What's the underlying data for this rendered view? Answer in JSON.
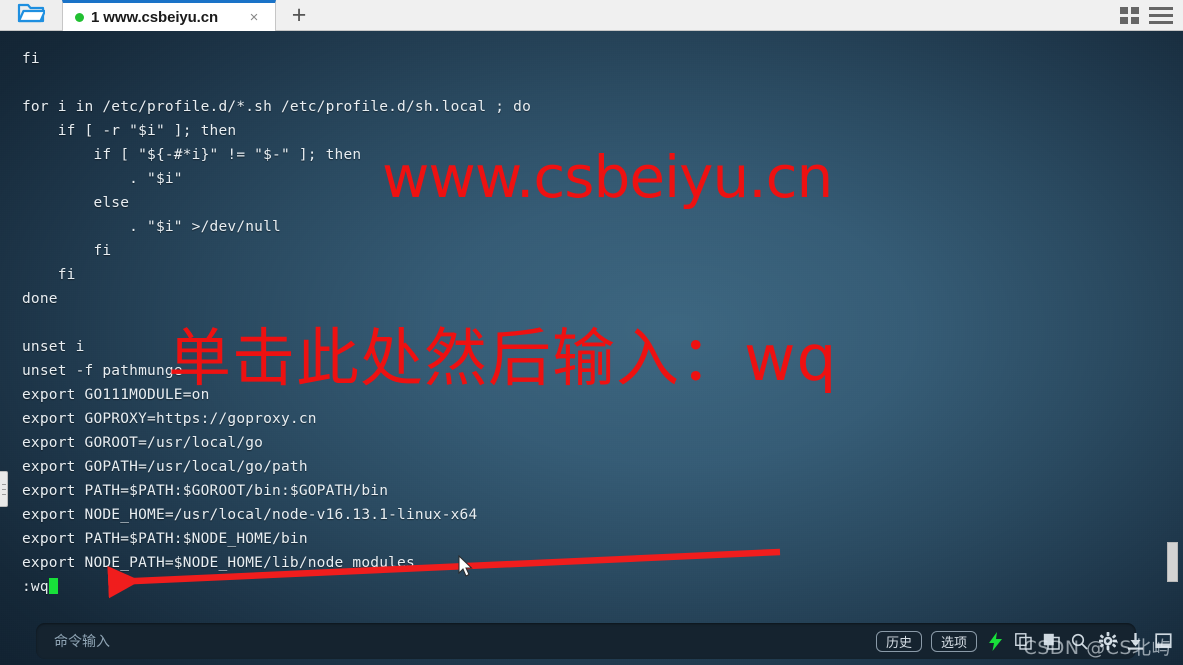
{
  "window": {
    "folder_icon": "open-folder-icon",
    "new_tab_label": "+",
    "grid_icon": "grid-view-icon",
    "menu_icon": "hamburger-menu-icon"
  },
  "tabs": [
    {
      "index": "1",
      "title": "1 www.csbeiyu.cn",
      "status_color": "#22c032",
      "close_label": "×",
      "active": true
    }
  ],
  "terminal": {
    "lines": [
      "fi",
      "",
      "for i in /etc/profile.d/*.sh /etc/profile.d/sh.local ; do",
      "    if [ -r \"$i\" ]; then",
      "        if [ \"${-#*i}\" != \"$-\" ]; then",
      "            . \"$i\"",
      "        else",
      "            . \"$i\" >/dev/null",
      "        fi",
      "    fi",
      "done",
      "",
      "unset i",
      "unset -f pathmunge",
      "export GO111MODULE=on",
      "export GOPROXY=https://goproxy.cn",
      "export GOROOT=/usr/local/go",
      "export GOPATH=/usr/local/go/path",
      "export PATH=$PATH:$GOROOT/bin:$GOPATH/bin",
      "export NODE_HOME=/usr/local/node-v16.13.1-linux-x64",
      "export PATH=$PATH:$NODE_HOME/bin",
      "export NODE_PATH=$NODE_HOME/lib/node_modules"
    ],
    "prompt_line": ":wq",
    "cursor_color": "#18e03a",
    "text_color": "#e8eef2",
    "background_color": "#2e5068"
  },
  "annotations": {
    "url_watermark": "www.csbeiyu.cn",
    "instruction": "单击此处然后输入：wq",
    "color": "#ee1111",
    "arrow": "left-pointing-arrow"
  },
  "command_bar": {
    "placeholder": "命令输入",
    "value": "",
    "buttons": [
      {
        "label": "历史",
        "name": "history-button"
      },
      {
        "label": "选项",
        "name": "options-button"
      }
    ],
    "icons": [
      {
        "name": "lightning-bolt-icon",
        "glyph": "⚡",
        "color": "#18e03a"
      },
      {
        "name": "copy-icon",
        "glyph": "❐",
        "color": "#cfd9e1"
      },
      {
        "name": "paste-icon",
        "glyph": "❑",
        "color": "#cfd9e1"
      },
      {
        "name": "search-icon",
        "glyph": "⚲",
        "color": "#cfd9e1"
      },
      {
        "name": "gear-icon",
        "glyph": "⚙",
        "color": "#cfd9e1"
      },
      {
        "name": "download-icon",
        "glyph": "⬇",
        "color": "#cfd9e1"
      },
      {
        "name": "minimize-icon",
        "glyph": "⬜",
        "color": "#cfd9e1"
      }
    ]
  },
  "watermark": "CSDN @CS北屿",
  "scrollbar": {
    "name": "vertical-scrollbar"
  }
}
